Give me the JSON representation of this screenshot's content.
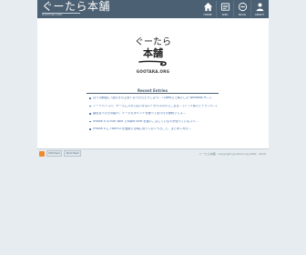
{
  "header": {
    "title": "ぐーたら本舗",
    "subtitle": "GOOTARA.ORG",
    "nav": [
      {
        "label": "HOME",
        "icon": "home-icon"
      },
      {
        "label": "WIKI",
        "icon": "wiki-icon"
      },
      {
        "label": "BLOG",
        "icon": "blog-icon"
      },
      {
        "label": "ABOUT",
        "icon": "about-icon"
      }
    ]
  },
  "logo": {
    "line1": "ぐーたら",
    "line2": "本舗",
    "url": "GOOTARA.ORG"
  },
  "recent": {
    "title": "Recent Entries",
    "items": [
      "買った瞬間に7割引き以上安くなったらどうしよう…? (Web上で購入した Windows PC…)",
      "ノートパソコン、ケースに入れてはいけない? ガラスの爪でこまる… (アプリ導入とトラブル…)",
      "最近買ったもの紹介。ぐーたらポイントを使って見つけた便利グッズ…",
      "iPhone X のTrue Tone とNight Shift を使いこなしている人が知っているコツ…",
      "iPhone X に Face ID を登録する時に知っておくべきこと、まとめてみた…"
    ]
  },
  "footer": {
    "feed_buttons": [
      "RSS Feed",
      "Atom Feed"
    ],
    "text": "ぐーたら本舗 - Copyright gootara.org 2009 - 2018"
  },
  "colors": {
    "header_bg": "#4b6073",
    "page_bg": "#e6ecef",
    "link": "#3b68a5"
  }
}
